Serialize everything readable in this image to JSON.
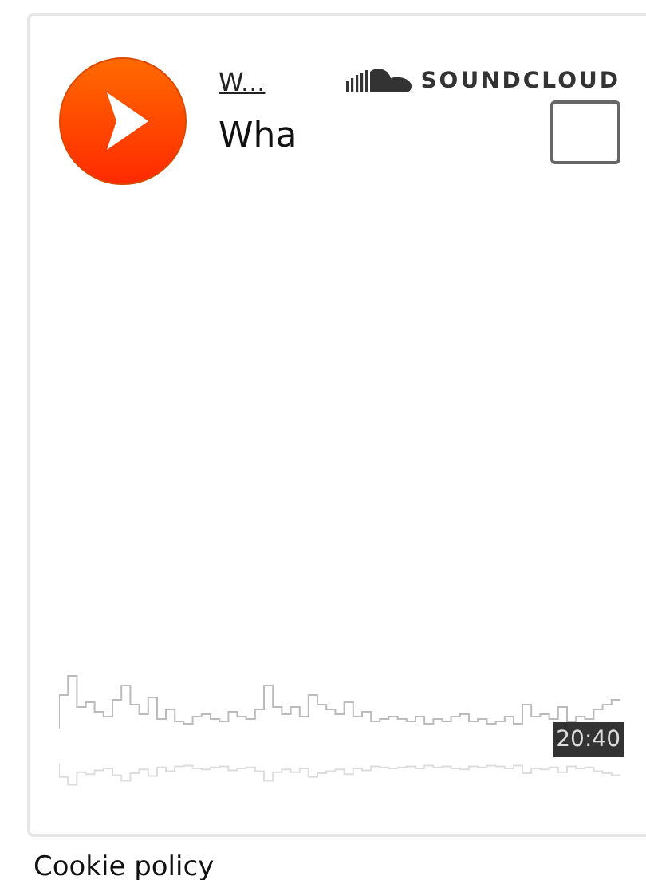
{
  "player": {
    "user": "W...",
    "title": "Wha",
    "brand": "SOUNDCLOUD",
    "selected": false,
    "duration": "20:40"
  },
  "footer": {
    "link": "Cookie policy"
  }
}
